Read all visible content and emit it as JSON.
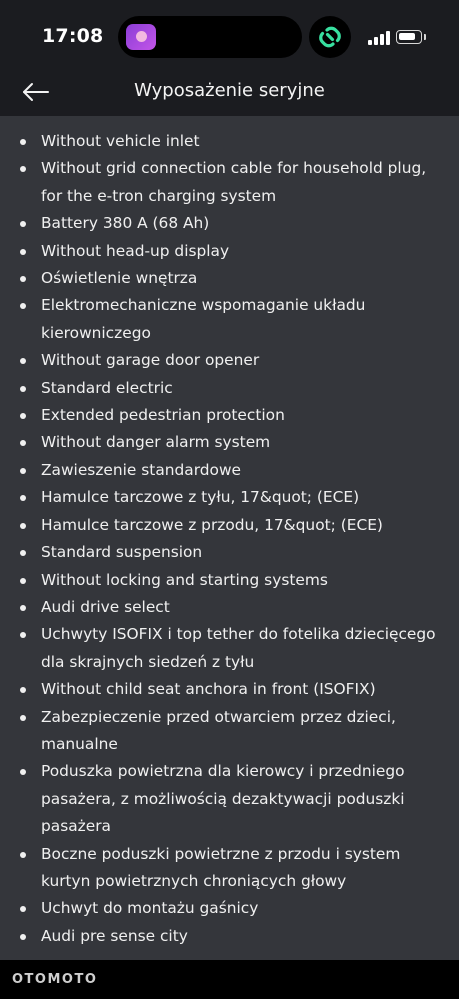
{
  "status_bar": {
    "time": "17:08",
    "battery_level": 0.85,
    "signal_bars": 4
  },
  "header": {
    "title": "Wyposażenie seryjne",
    "back_icon": "arrow-left-icon"
  },
  "equipment_items": [
    "Without vehicle inlet",
    "Without grid connection cable for household plug, for the e-tron charging system",
    "Battery 380 A (68 Ah)",
    "Without head-up display",
    "Oświetlenie wnętrza",
    "Elektromechaniczne wspomaganie układu kierowniczego",
    "Without garage door opener",
    "Standard electric",
    "Extended pedestrian protection",
    "Without danger alarm system",
    "Zawieszenie standardowe",
    "Hamulce tarczowe z tyłu, 17&quot; (ECE)",
    "Hamulce tarczowe z przodu, 17&quot; (ECE)",
    "Standard suspension",
    "Without locking and starting systems",
    "Audi drive select",
    "Uchwyty ISOFIX i top tether do fotelika dziecięcego dla skrajnych siedzeń z tyłu",
    "Without child seat anchora in front (ISOFIX)",
    "Zabezpieczenie przed otwarciem przez dzieci, manualne",
    "Poduszka powietrzna dla kierowcy i przedniego pasażera, z możliwością dezaktywacji poduszki pasażera",
    "Boczne poduszki powietrzne z przodu i system kurtyn powietrznych chroniących głowy",
    "Uchwyt do montażu gaśnicy",
    "Audi pre sense city"
  ],
  "footer": {
    "brand": "OTOMOTO"
  },
  "colors": {
    "background": "#34363b",
    "header_background": "#1b1c20",
    "footer_background": "#000000",
    "text": "#f0f0f0"
  }
}
